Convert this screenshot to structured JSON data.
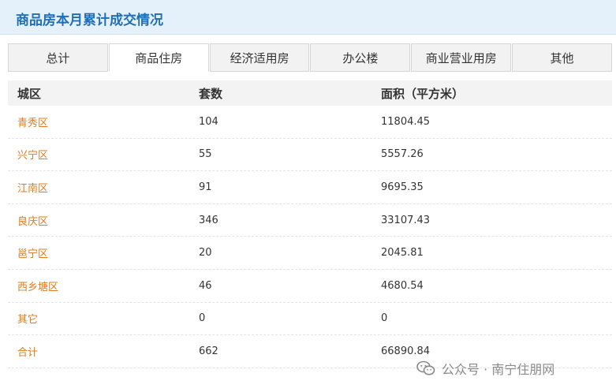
{
  "header": {
    "title": "商品房本月累计成交情况"
  },
  "tabs": [
    {
      "label": "总计",
      "active": false
    },
    {
      "label": "商品住房",
      "active": true
    },
    {
      "label": "经济适用房",
      "active": false
    },
    {
      "label": "办公楼",
      "active": false
    },
    {
      "label": "商业营业用房",
      "active": false
    },
    {
      "label": "其他",
      "active": false
    }
  ],
  "table": {
    "columns": [
      "城区",
      "套数",
      "面积（平方米）"
    ],
    "rows": [
      [
        "青秀区",
        "104",
        "11804.45"
      ],
      [
        "兴宁区",
        "55",
        "5557.26"
      ],
      [
        "江南区",
        "91",
        "9695.35"
      ],
      [
        "良庆区",
        "346",
        "33107.43"
      ],
      [
        "邕宁区",
        "20",
        "2045.81"
      ],
      [
        "西乡塘区",
        "46",
        "4680.54"
      ],
      [
        "其它",
        "0",
        "0"
      ],
      [
        "合计",
        "662",
        "66890.84"
      ]
    ]
  },
  "watermark": {
    "text": "公众号 · 南宁住朋网",
    "icon": "wechat-icon"
  },
  "colors": {
    "title": "#1f6fb5",
    "district": "#e07b1f",
    "header_bg": "#e4f1fa"
  }
}
